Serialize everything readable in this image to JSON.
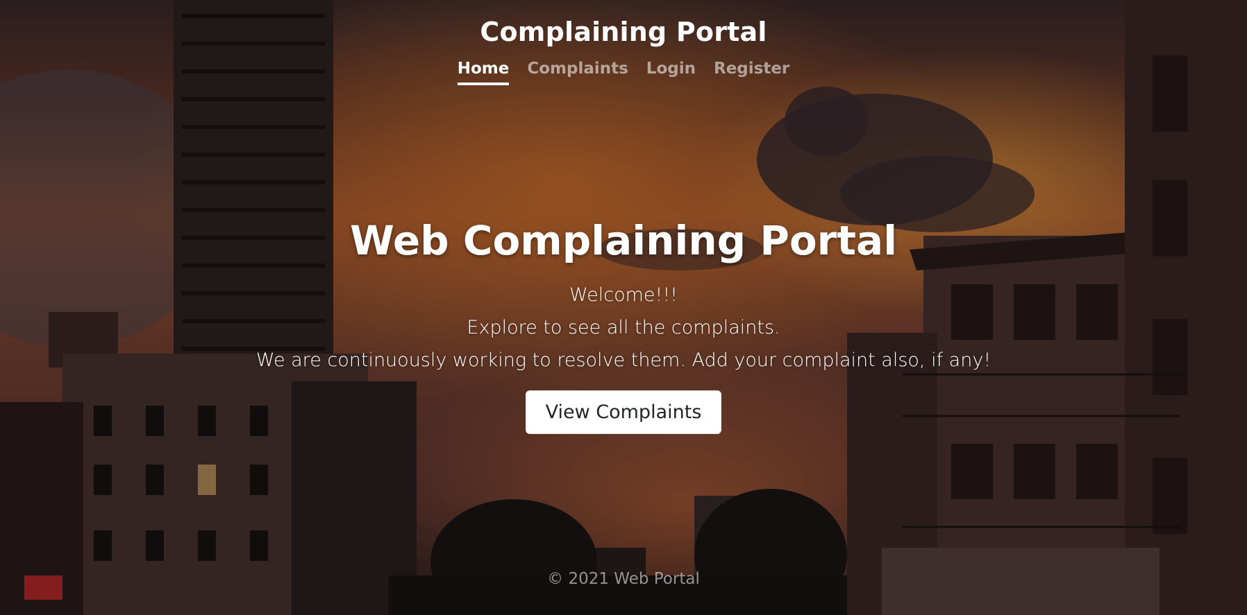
{
  "header": {
    "brand": "Complaining Portal",
    "nav": [
      {
        "label": "Home",
        "active": true
      },
      {
        "label": "Complaints",
        "active": false
      },
      {
        "label": "Login",
        "active": false
      },
      {
        "label": "Register",
        "active": false
      }
    ]
  },
  "hero": {
    "title": "Web Complaining Portal",
    "lines": [
      "Welcome!!!",
      "Explore to see all the complaints.",
      "We are continuously working to resolve them. Add your complaint also, if any!"
    ],
    "button_label": "View Complaints"
  },
  "footer": {
    "text": "© 2021 Web Portal"
  },
  "colors": {
    "text": "#ffffff",
    "muted_text": "rgba(255,255,255,0.55)",
    "button_bg": "#ffffff",
    "button_text": "#212529"
  }
}
